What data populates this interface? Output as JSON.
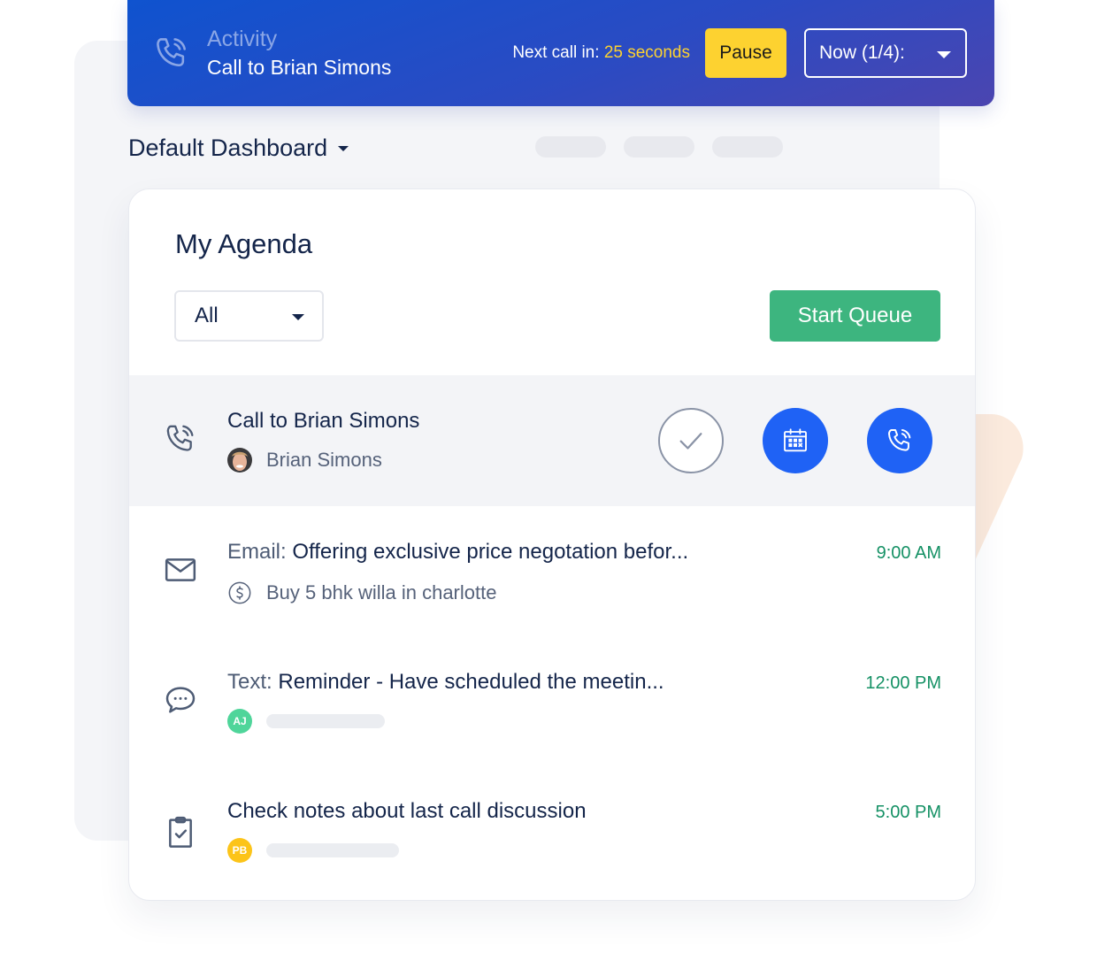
{
  "banner": {
    "icon": "phone-call-icon",
    "subtitle": "Activity",
    "title": "Call to Brian Simons",
    "next_call_label": "Next call in:",
    "next_call_countdown": "25 seconds",
    "pause_label": "Pause",
    "queue_select_value": "Now (1/4):"
  },
  "dashboard": {
    "title": "Default Dashboard"
  },
  "agenda": {
    "title": "My Agenda",
    "filter_value": "All",
    "start_queue_label": "Start Queue",
    "items": [
      {
        "type": "call",
        "icon": "phone-call-icon",
        "kind": "",
        "title": "Call to Brian Simons",
        "contact": "Brian Simons",
        "actions": [
          "complete-check",
          "reschedule-calendar",
          "call-phone"
        ]
      },
      {
        "type": "email",
        "icon": "envelope-icon",
        "kind": "Email:",
        "title": "Offering exclusive price negotation befor...",
        "deal": "Buy 5 bhk willa in charlotte",
        "time": "9:00 AM"
      },
      {
        "type": "text",
        "icon": "chat-bubble-icon",
        "kind": "Text:",
        "title": "Reminder - Have scheduled the meetin...",
        "avatar_initials": "AJ",
        "time": "12:00 PM"
      },
      {
        "type": "task",
        "icon": "clipboard-check-icon",
        "kind": "",
        "title": "Check notes about last call discussion",
        "avatar_initials": "PB",
        "time": "5:00 PM"
      }
    ]
  },
  "colors": {
    "banner_start": "#0f53cf",
    "banner_end": "#4b45b0",
    "accent_yellow": "#fdd230",
    "primary_blue": "#1f62f5",
    "success_green": "#3db57f",
    "time_green": "#159165",
    "avatar_aj": "#4fd59a",
    "avatar_pb": "#fcc419"
  }
}
